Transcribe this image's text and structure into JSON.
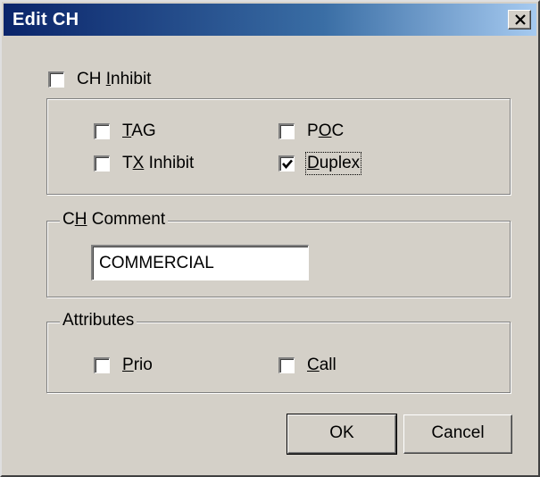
{
  "window": {
    "title": "Edit CH",
    "close_label": "Close"
  },
  "checkboxes": {
    "ch_inhibit": {
      "label_pre": "CH ",
      "label_key": "I",
      "label_post": "nhibit",
      "checked": false
    },
    "tag": {
      "label_pre": "",
      "label_key": "T",
      "label_post": "AG",
      "checked": false
    },
    "tx_inhibit": {
      "label_pre": "T",
      "label_key": "X",
      "label_post": " Inhibit",
      "checked": false
    },
    "poc": {
      "label_pre": "P",
      "label_key": "O",
      "label_post": "C",
      "checked": false
    },
    "duplex": {
      "label_pre": "",
      "label_key": "D",
      "label_post": "uplex",
      "checked": true
    }
  },
  "comment_group": {
    "legend_pre": "C",
    "legend_key": "H",
    "legend_post": " Comment",
    "value": "COMMERCIAL"
  },
  "attributes_group": {
    "legend": "Attributes",
    "prio": {
      "label_pre": "",
      "label_key": "P",
      "label_post": "rio",
      "checked": false
    },
    "call": {
      "label_pre": "",
      "label_key": "C",
      "label_post": "all",
      "checked": false
    }
  },
  "buttons": {
    "ok": "OK",
    "cancel": "Cancel"
  },
  "icons": {
    "close": "close-icon",
    "checkmark": "checkmark-icon"
  }
}
